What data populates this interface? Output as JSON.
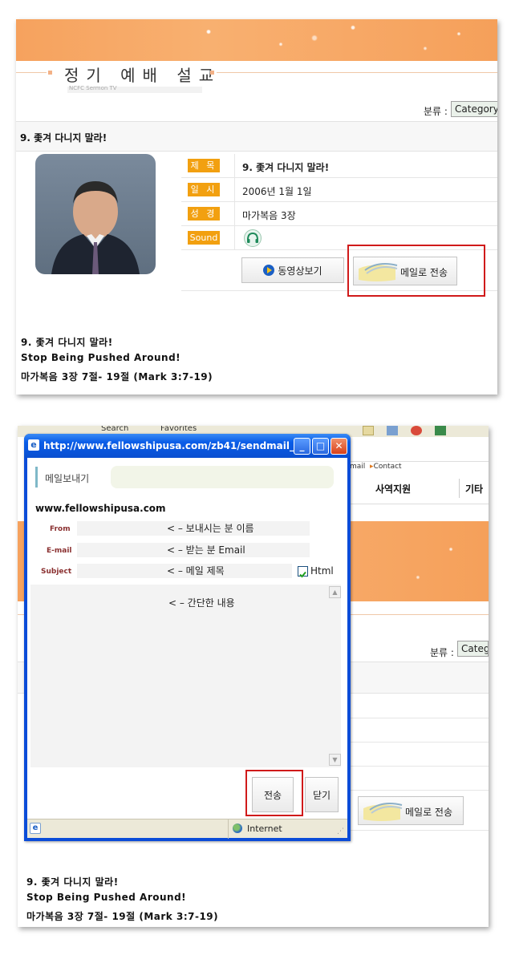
{
  "top_page": {
    "page_title": "정기 예배 설교",
    "subtitle": "NCFC Sermon TV",
    "category_label": "분류 :",
    "category_select": "Category",
    "sermon_heading": "9. 좇겨 다니지 말라!",
    "info": [
      {
        "label": "제 목",
        "value": "9. 좇겨 다니지 말라!"
      },
      {
        "label": "일 시",
        "value": "2006년 1월 1일"
      },
      {
        "label": "성 경",
        "value": "마가복음 3장"
      },
      {
        "label": "Sound",
        "value": ""
      }
    ],
    "video_button": "동영상보기",
    "email_button": "메일로 전송",
    "bottom_lines": [
      "9. 좇겨 다니지 말라!",
      "Stop Being Pushed Around!",
      "마가복음 3장 7절- 19절 (Mark 3:7-19)"
    ]
  },
  "popup": {
    "browser_toolbar": [
      "Search",
      "Favorites"
    ],
    "title_url": "http://www.fellowshipusa.com/zb41/sendmail_...",
    "header": "메일보내기",
    "site": "www.fellowshipusa.com",
    "fields": [
      {
        "label": "From",
        "hint": "< – 보내시는 분 이름"
      },
      {
        "label": "E-mail",
        "hint": "< – 받는 분 Email"
      },
      {
        "label": "Subject",
        "hint": "< – 메일 제목"
      }
    ],
    "html_checkbox_label": "Html",
    "html_checked": true,
    "body_hint": "< – 간단한 내용",
    "send_button": "전송",
    "close_button": "닫기",
    "status_zone": "Internet"
  },
  "behind_page": {
    "top_links": [
      "mail",
      "Contact"
    ],
    "nav": [
      "사역지원",
      "기타"
    ],
    "category_label": "분류 :",
    "category_select": "Categ",
    "email_button": "메일로 전송",
    "bottom_lines": [
      "9. 좇겨 다니지 말라!",
      "Stop Being Pushed Around!",
      "마가복음 3장 7절- 19절 (Mark 3:7-19)"
    ]
  },
  "colors": {
    "accent_orange": "#f2a010",
    "banner_orange": "#f6a25e",
    "highlight_red": "#d01a1a",
    "xp_blue": "#0a4fd0"
  }
}
